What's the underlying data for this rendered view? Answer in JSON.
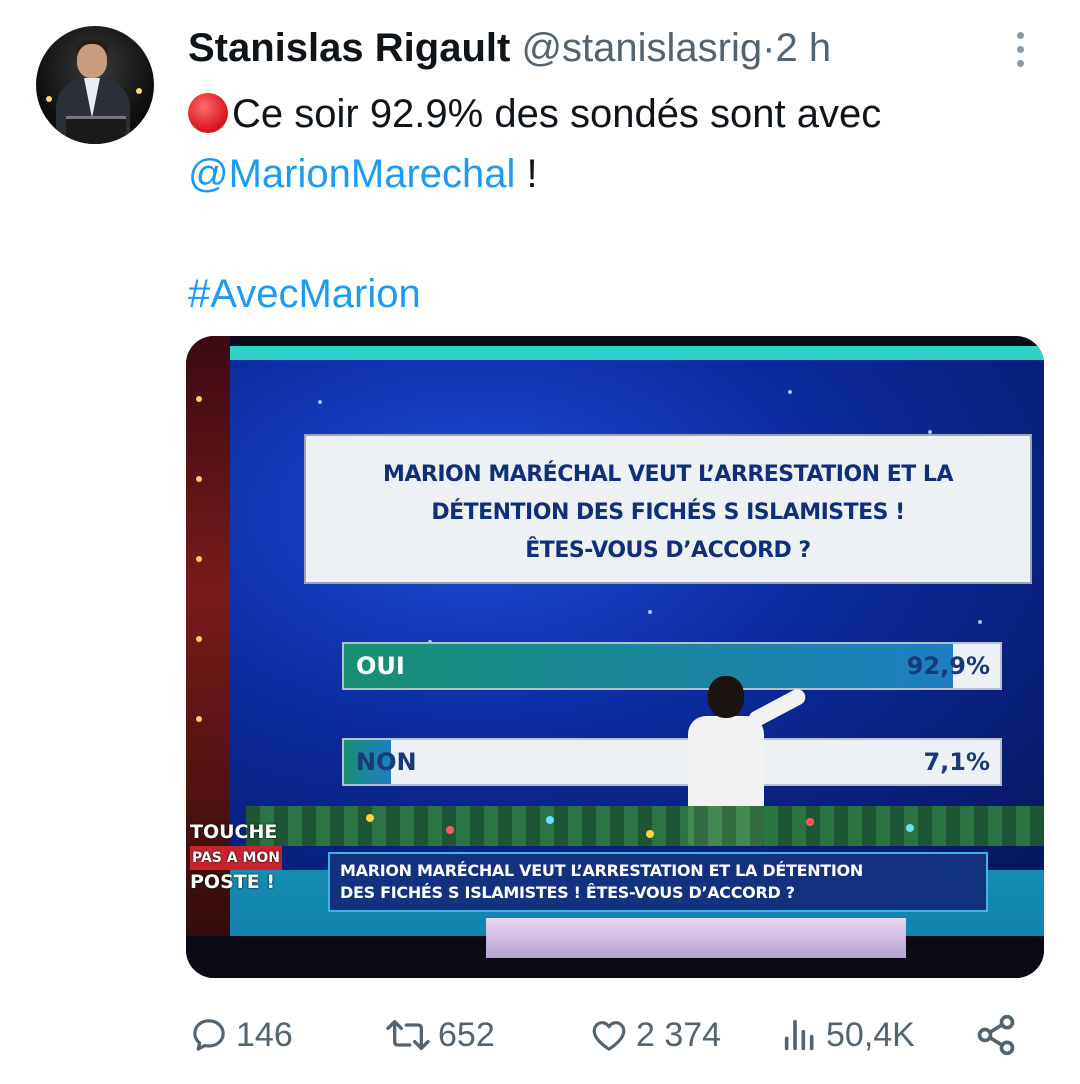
{
  "tweet": {
    "author_name": "Stanislas Rigault",
    "author_handle": "@stanislasrig",
    "separator": "·",
    "time": "2 h",
    "text_line1": "Ce soir 92.9% des sondés sont avec",
    "mention": "@MarionMarechal",
    "text_after_mention": " !",
    "hashtag": "#AvecMarion"
  },
  "media": {
    "question_line1": "MARION MARÉCHAL VEUT L’ARRESTATION ET LA",
    "question_line2": "DÉTENTION DES FICHÉS S ISLAMISTES !",
    "question_line3": "ÊTES-VOUS D’ACCORD ?",
    "poll": [
      {
        "label": "OUI",
        "value_text": "92,9%",
        "value": 92.9
      },
      {
        "label": "NON",
        "value_text": "7,1%",
        "value": 7.1
      }
    ],
    "logo_line1": "TOUCHE",
    "logo_line2": "PAS A MON",
    "logo_line3": "POSTE !",
    "ticker_line1": "MARION MARÉCHAL VEUT L’ARRESTATION ET LA DÉTENTION",
    "ticker_line2": "DES FICHÉS S ISLAMISTES ! ÊTES-VOUS D’ACCORD ?"
  },
  "actions": {
    "replies": "146",
    "retweets": "652",
    "likes": "2 374",
    "views": "50,4K"
  },
  "icons": [
    "more-icon",
    "red-circle-icon",
    "reply-icon",
    "retweet-icon",
    "like-icon",
    "views-icon",
    "share-icon"
  ],
  "colors": {
    "link": "#1d9bf0",
    "secondary_text": "#536471",
    "poll_fill": "#178f73"
  }
}
